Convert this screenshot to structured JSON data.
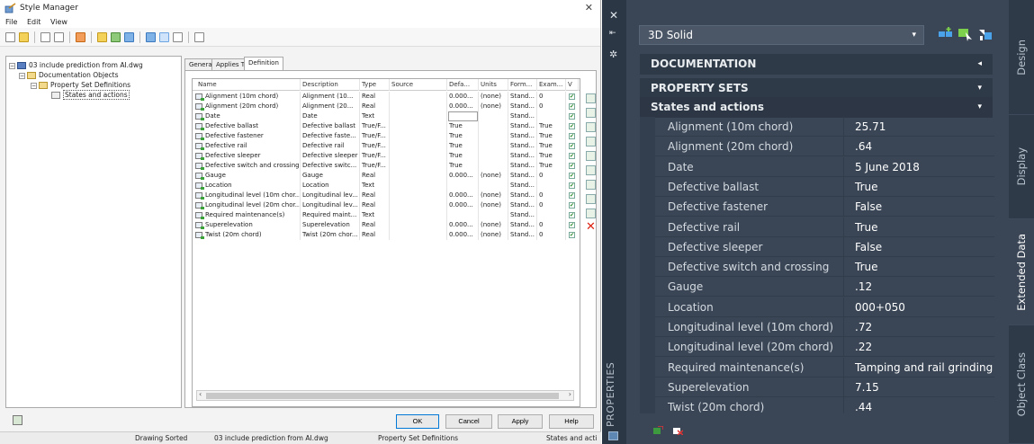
{
  "style_manager": {
    "title": "Style Manager",
    "close_glyph": "✕",
    "menu": [
      "File",
      "Edit",
      "View"
    ],
    "tree": [
      {
        "label": "03 include prediction from AI.dwg",
        "expander": "−",
        "icon": "drawing-icon"
      },
      {
        "label": "Documentation Objects",
        "expander": "−",
        "icon": "folder-icon"
      },
      {
        "label": "Property Set Definitions",
        "expander": "−",
        "icon": "folder-icon"
      },
      {
        "label": "States and actions",
        "expander": "",
        "icon": "property-set-icon"
      }
    ],
    "tabs": [
      "General",
      "Applies To",
      "Definition"
    ],
    "active_tab": "Definition",
    "columns": [
      "Name",
      "Description",
      "Type",
      "Source",
      "Defa...",
      "Units",
      "Form...",
      "Exam...",
      "V"
    ],
    "rows": [
      [
        "Alignment (10m chord)",
        "Alignment (10...",
        "Real",
        "",
        "0.000...",
        "(none)",
        "Stand...",
        "0"
      ],
      [
        "Alignment (20m chord)",
        "Alignment (20...",
        "Real",
        "",
        "0.000...",
        "(none)",
        "Stand...",
        "0"
      ],
      [
        "Date",
        "Date",
        "Text",
        "",
        "",
        "",
        "Stand...",
        ""
      ],
      [
        "Defective ballast",
        "Defective ballast",
        "True/F...",
        "",
        "True",
        "",
        "Stand...",
        "True"
      ],
      [
        "Defective fastener",
        "Defective faste...",
        "True/F...",
        "",
        "True",
        "",
        "Stand...",
        "True"
      ],
      [
        "Defective rail",
        "Defective rail",
        "True/F...",
        "",
        "True",
        "",
        "Stand...",
        "True"
      ],
      [
        "Defective sleeper",
        "Defective sleeper",
        "True/F...",
        "",
        "True",
        "",
        "Stand...",
        "True"
      ],
      [
        "Defective switch and crossing",
        "Defective switc...",
        "True/F...",
        "",
        "True",
        "",
        "Stand...",
        "True"
      ],
      [
        "Gauge",
        "Gauge",
        "Real",
        "",
        "0.000...",
        "(none)",
        "Stand...",
        "0"
      ],
      [
        "Location",
        "Location",
        "Text",
        "",
        "",
        "",
        "Stand...",
        ""
      ],
      [
        "Longitudinal level (10m chor...",
        "Longitudinal lev...",
        "Real",
        "",
        "0.000...",
        "(none)",
        "Stand...",
        "0"
      ],
      [
        "Longitudinal level (20m chor...",
        "Longitudinal lev...",
        "Real",
        "",
        "0.000...",
        "(none)",
        "Stand...",
        "0"
      ],
      [
        "Required maintenance(s)",
        "Required maint...",
        "Text",
        "",
        "",
        "",
        "Stand...",
        ""
      ],
      [
        "Superelevation",
        "Superelevation",
        "Real",
        "",
        "0.000...",
        "(none)",
        "Stand...",
        "0"
      ],
      [
        "Twist (20m chord)",
        "Twist (20m chor...",
        "Real",
        "",
        "0.000...",
        "(none)",
        "Stand...",
        "0"
      ]
    ],
    "visible_checked": "✔",
    "scroll_left": "‹",
    "scroll_right": "›",
    "delete_glyph": "✕",
    "buttons": {
      "ok": "OK",
      "cancel": "Cancel",
      "apply": "Apply",
      "help": "Help"
    },
    "status": [
      "Drawing Sorted",
      "03 include prediction from AI.dwg",
      "Property Set Definitions",
      "States and acti"
    ]
  },
  "properties_palette": {
    "close_glyph": "✕",
    "pin_glyph": "⇤",
    "settings_glyph": "✲",
    "palette_title": "PROPERTIES",
    "object_type": "3D Solid",
    "combo_arrow": "▾",
    "sections": {
      "documentation": {
        "label": "DOCUMENTATION",
        "caret": "◂"
      },
      "property_sets": {
        "label": "PROPERTY SETS",
        "caret": "▾"
      },
      "states_and_actions": {
        "label": "States and actions",
        "caret": "▾"
      }
    },
    "properties": [
      {
        "name": "Alignment (10m chord)",
        "value": "25.71"
      },
      {
        "name": "Alignment (20m chord)",
        "value": ".64"
      },
      {
        "name": "Date",
        "value": "5 June 2018"
      },
      {
        "name": "Defective ballast",
        "value": "True"
      },
      {
        "name": "Defective fastener",
        "value": "False"
      },
      {
        "name": "Defective rail",
        "value": "True"
      },
      {
        "name": "Defective sleeper",
        "value": "False"
      },
      {
        "name": "Defective switch and crossing",
        "value": "True"
      },
      {
        "name": "Gauge",
        "value": ".12"
      },
      {
        "name": "Location",
        "value": "000+050"
      },
      {
        "name": "Longitudinal level (10m chord)",
        "value": ".72"
      },
      {
        "name": "Longitudinal level (20m chord)",
        "value": ".22"
      },
      {
        "name": "Required maintenance(s)",
        "value": "Tamping and rail grinding"
      },
      {
        "name": "Superelevation",
        "value": "7.15"
      },
      {
        "name": "Twist (20m chord)",
        "value": ".44"
      }
    ],
    "side_tabs": [
      "Design",
      "Display",
      "Extended Data",
      "Object Class"
    ],
    "active_side_tab": "Extended Data"
  }
}
